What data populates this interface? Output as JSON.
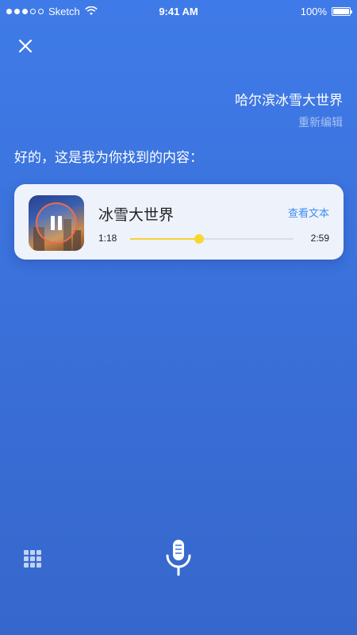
{
  "status_bar": {
    "carrier": "Sketch",
    "time": "9:41 AM",
    "battery": "100%"
  },
  "query": {
    "text": "哈尔滨冰雪大世界",
    "edit_label": "重新编辑"
  },
  "reply": "好的，这是我为你找到的内容：",
  "card": {
    "title": "冰雪大世界",
    "view_text_label": "查看文本",
    "current_time": "1:18",
    "total_time": "2:59",
    "progress": 0.42
  },
  "icons": {
    "close": "close-icon",
    "pause": "pause-icon",
    "keyboard": "keyboard-grid-icon",
    "mic": "microphone-icon"
  },
  "colors": {
    "background_top": "#3f7be8",
    "accent_link": "#3f8ff0",
    "progress": "#f5d23a",
    "ring": "#f06a4d"
  }
}
